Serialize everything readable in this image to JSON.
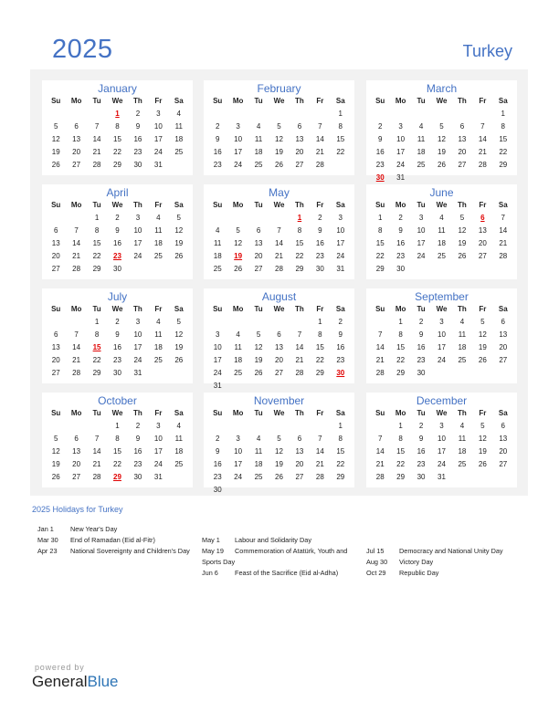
{
  "header": {
    "year": "2025",
    "country": "Turkey"
  },
  "day_names": [
    "Su",
    "Mo",
    "Tu",
    "We",
    "Th",
    "Fr",
    "Sa"
  ],
  "months": [
    {
      "name": "January",
      "start": 3,
      "days": 31,
      "holidays": [
        1
      ]
    },
    {
      "name": "February",
      "start": 6,
      "days": 28,
      "holidays": []
    },
    {
      "name": "March",
      "start": 6,
      "days": 31,
      "holidays": [
        30
      ]
    },
    {
      "name": "April",
      "start": 2,
      "days": 30,
      "holidays": [
        23
      ]
    },
    {
      "name": "May",
      "start": 4,
      "days": 31,
      "holidays": [
        1,
        19
      ]
    },
    {
      "name": "June",
      "start": 0,
      "days": 30,
      "holidays": [
        6
      ]
    },
    {
      "name": "July",
      "start": 2,
      "days": 31,
      "holidays": [
        15
      ]
    },
    {
      "name": "August",
      "start": 5,
      "days": 31,
      "holidays": [
        30
      ]
    },
    {
      "name": "September",
      "start": 1,
      "days": 30,
      "holidays": []
    },
    {
      "name": "October",
      "start": 3,
      "days": 31,
      "holidays": [
        29
      ]
    },
    {
      "name": "November",
      "start": 6,
      "days": 30,
      "holidays": []
    },
    {
      "name": "December",
      "start": 1,
      "days": 31,
      "holidays": []
    }
  ],
  "holidays_title": "2025 Holidays for Turkey",
  "holiday_columns": [
    [
      {
        "date": "Jan 1",
        "name": "New Year's Day"
      },
      {
        "date": "Mar 30",
        "name": "End of Ramadan (Eid al-Fitr)"
      },
      {
        "date": "Apr 23",
        "name": "National Sovereignty and Children's Day"
      }
    ],
    [
      {
        "date": "May 1",
        "name": "Labour and Solidarity Day"
      },
      {
        "date": "May 19",
        "name": "Commemoration of Atatürk, Youth and Sports Day"
      },
      {
        "date": "Jun 6",
        "name": "Feast of the Sacrifice (Eid al-Adha)"
      }
    ],
    [
      {
        "date": "Jul 15",
        "name": "Democracy and National Unity Day"
      },
      {
        "date": "Aug 30",
        "name": "Victory Day"
      },
      {
        "date": "Oct 29",
        "name": "Republic Day"
      }
    ]
  ],
  "footer": {
    "powered_by": "powered by",
    "brand_general": "General",
    "brand_blue": "Blue"
  },
  "colors": {
    "accent": "#4472c4",
    "holiday": "#e00000"
  }
}
